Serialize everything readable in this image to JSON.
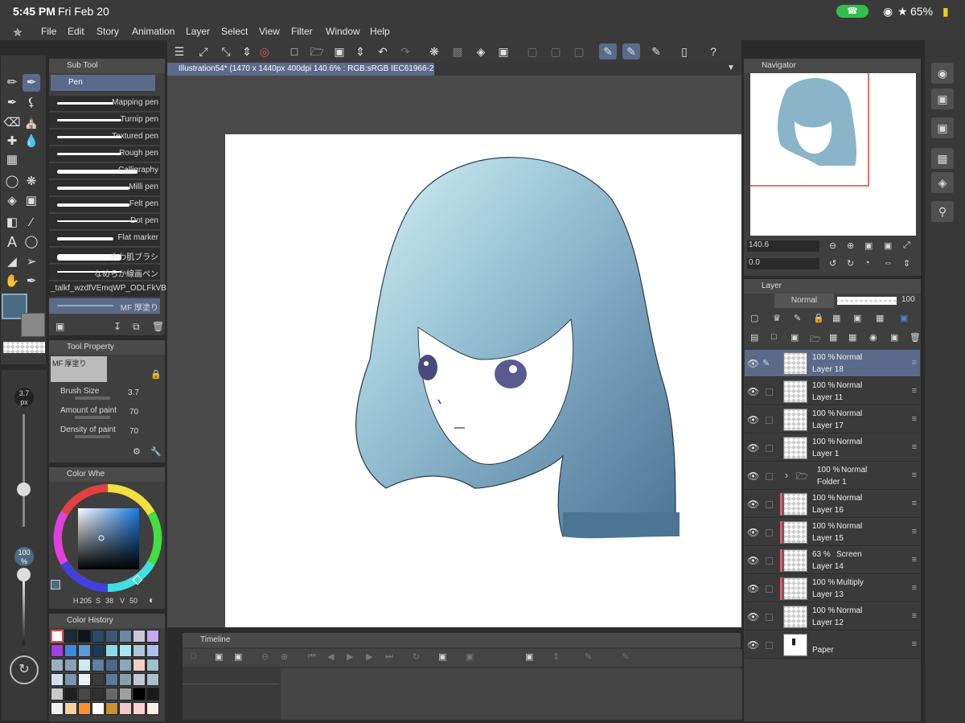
{
  "status": {
    "time": "5:45 PM",
    "date": "Fri Feb 20",
    "battery": "65%"
  },
  "menu": [
    "File",
    "Edit",
    "Story",
    "Animation",
    "Layer",
    "Select",
    "View",
    "Filter",
    "Window",
    "Help"
  ],
  "doc_tab": "Illustration54* (1470 x 1440px 400dpi 140.6% : RGB:sRGB IEC61966-2.1)",
  "subtool": {
    "title": "Sub Tool",
    "group": "Pen",
    "items": [
      "Mapping pen",
      "Turnip pen",
      "Textured pen",
      "Rough pen",
      "Calligraphy",
      "Milli pen",
      "Felt pen",
      "Dot pen",
      "Flat marker",
      "やわ肌ブラシ",
      "なめらか線画ペン",
      "_talkf_wzdfVEmqWP_ODLFkVB",
      "MF 厚塗り"
    ]
  },
  "tool_property": {
    "title": "Tool Property",
    "preset": "MF 厚塗り",
    "params": [
      {
        "label": "Brush Size",
        "value": "3.7"
      },
      {
        "label": "Amount of paint",
        "value": "70"
      },
      {
        "label": "Density of paint",
        "value": "70"
      }
    ]
  },
  "brush_size": {
    "value": "3.7",
    "unit": "px"
  },
  "opacity": {
    "value": "100",
    "unit": "%"
  },
  "color_wheel": {
    "title": "Color Whe",
    "h": "205",
    "s": "38",
    "v": "50",
    "h_label": "H",
    "s_label": "S",
    "v_label": "V",
    "main_color": "#4b6a84"
  },
  "color_history": {
    "title": "Color History",
    "colors": [
      "#ffffff",
      "#1a2a3a",
      "#0d1620",
      "#2a4a6a",
      "#3a5a78",
      "#6a8aa4",
      "#c8c8d8",
      "#c8a8f0",
      "#a040e0",
      "#3a8ae0",
      "#5a9ad8",
      "#1a3a5a",
      "#8adae8",
      "#a8e8f0",
      "#b0c8d8",
      "#b0c0f0",
      "#9ab0c0",
      "#88a0b8",
      "#d0e8f0",
      "#6080a0",
      "#4a6a88",
      "#8aa8b8",
      "#f0d0c0",
      "#a0c0d0",
      "#d0e0e8",
      "#7898b0",
      "#e8f0f8",
      "#3a3a3a",
      "#5a7a9a",
      "#88a0a8",
      "#c0c8d0",
      "#a8c0c8",
      "#c8c8c8",
      "#202020",
      "#484848",
      "#303030",
      "#686868",
      "#a0a0a0",
      "#000000",
      "#1a1a1a",
      "#f0f0f0",
      "#f8d0a0",
      "#f89030",
      "#ffffff",
      "#c89030",
      "#f0c8c8",
      "#ffd0d0",
      "#f8f0e0"
    ]
  },
  "navigator": {
    "title": "Navigator",
    "zoom": "140.6",
    "rotate": "0.0"
  },
  "layer_panel": {
    "title": "Layer",
    "blend": "Normal",
    "opacity": "100",
    "layers": [
      {
        "pct": "100 %",
        "mode": "Normal",
        "name": "Layer 18",
        "selected": true,
        "clip": false
      },
      {
        "pct": "100 %",
        "mode": "Normal",
        "name": "Layer 11",
        "clip": false
      },
      {
        "pct": "100 %",
        "mode": "Normal",
        "name": "Layer 17",
        "clip": false
      },
      {
        "pct": "100 %",
        "mode": "Normal",
        "name": "Layer 1",
        "clip": false
      },
      {
        "pct": "100 %",
        "mode": "Normal",
        "name": "Folder 1",
        "folder": true,
        "clip": false
      },
      {
        "pct": "100 %",
        "mode": "Normal",
        "name": "Layer 16",
        "clip": true
      },
      {
        "pct": "100 %",
        "mode": "Normal",
        "name": "Layer 15",
        "clip": true
      },
      {
        "pct": "63 %",
        "mode": "Screen",
        "name": "Layer 14",
        "clip": true
      },
      {
        "pct": "100 %",
        "mode": "Multiply",
        "name": "Layer 13",
        "clip": true
      },
      {
        "pct": "100 %",
        "mode": "Normal",
        "name": "Layer 12",
        "clip": false
      },
      {
        "pct": "",
        "mode": "",
        "name": "Paper",
        "paper": true,
        "clip": false
      }
    ]
  },
  "timeline": {
    "title": "Timeline"
  }
}
